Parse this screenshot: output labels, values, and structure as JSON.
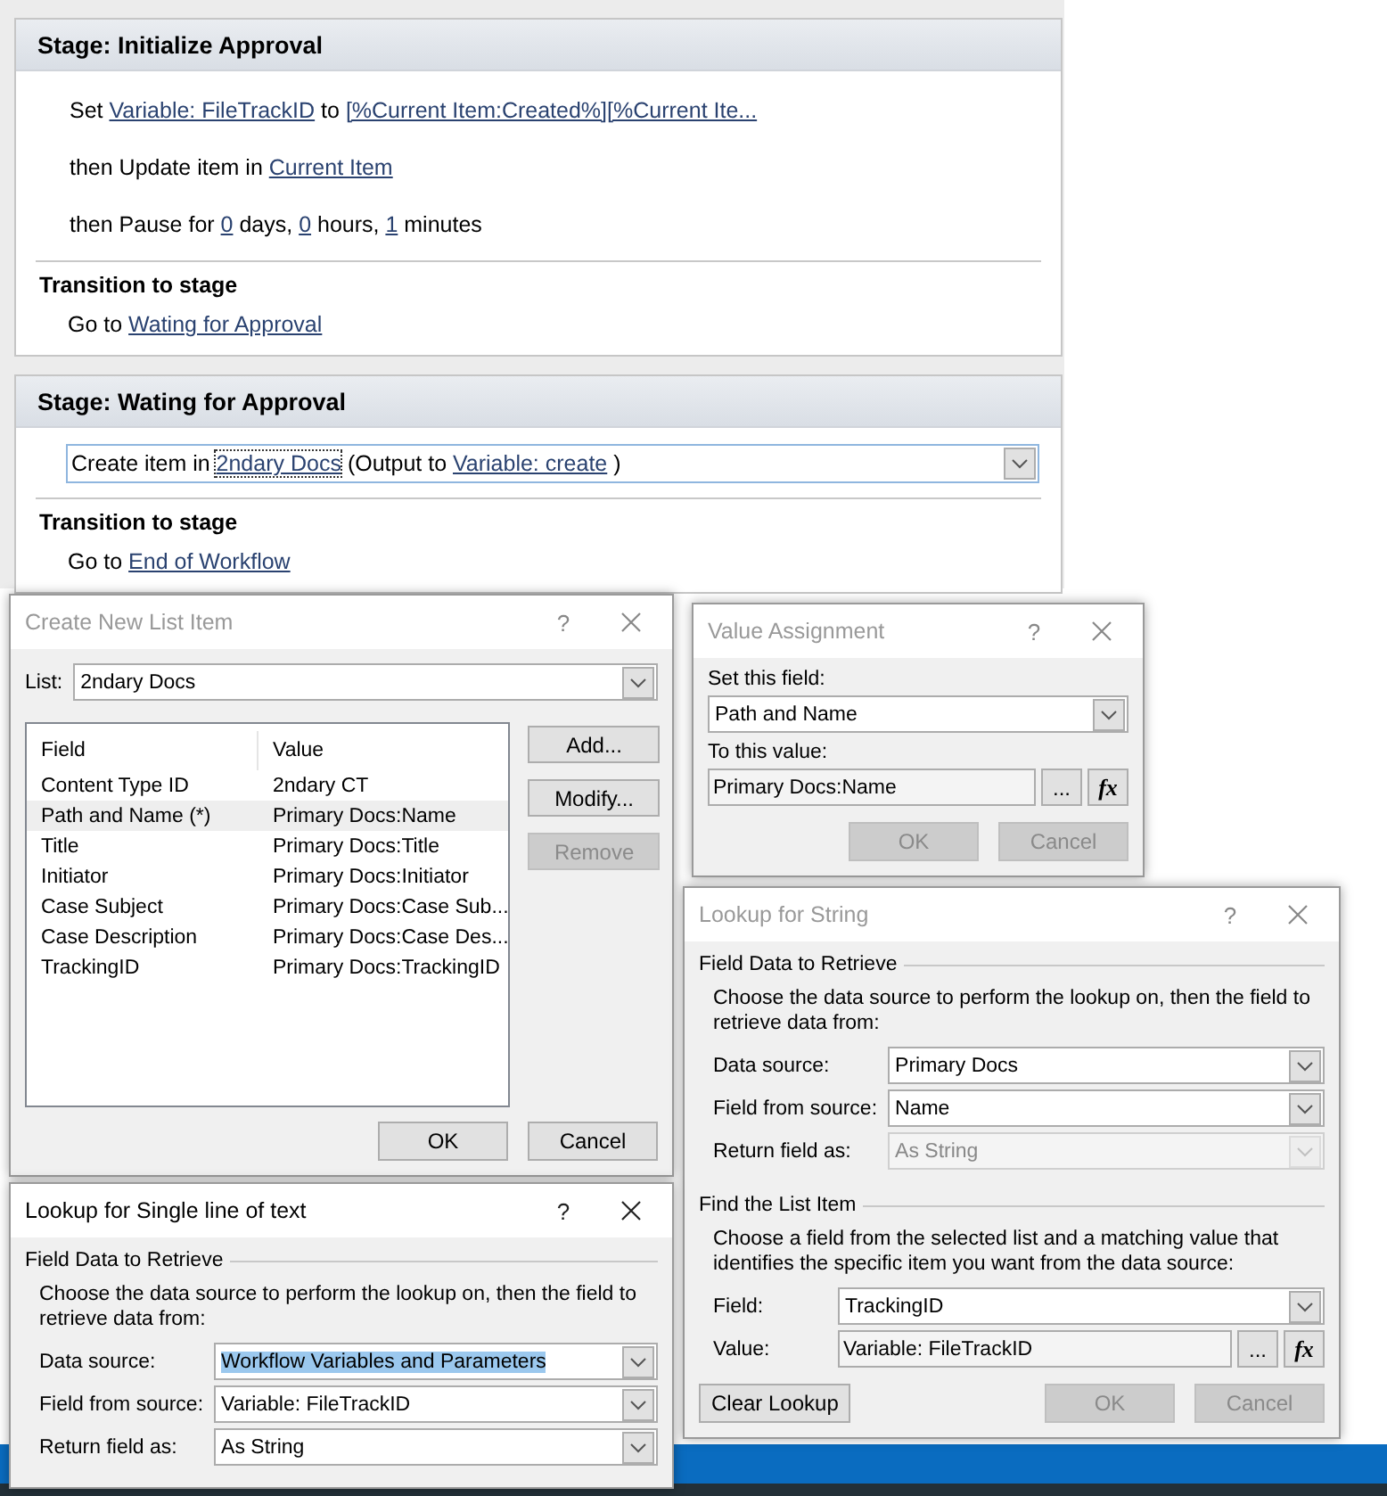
{
  "stages": [
    {
      "title": "Stage: Initialize Approval",
      "actions": [
        {
          "selected": false,
          "parts": [
            {
              "kind": "text",
              "text": "Set "
            },
            {
              "kind": "link",
              "text": "Variable: FileTrackID"
            },
            {
              "kind": "text",
              "text": " to "
            },
            {
              "kind": "link",
              "text": "[%Current Item:Created%][%Current Ite..."
            }
          ]
        },
        {
          "selected": false,
          "parts": [
            {
              "kind": "text",
              "text": "then Update item in "
            },
            {
              "kind": "link",
              "text": "Current Item"
            }
          ]
        },
        {
          "selected": false,
          "parts": [
            {
              "kind": "text",
              "text": "then Pause for "
            },
            {
              "kind": "link",
              "text": "0"
            },
            {
              "kind": "text",
              "text": " days, "
            },
            {
              "kind": "link",
              "text": "0"
            },
            {
              "kind": "text",
              "text": " hours, "
            },
            {
              "kind": "link",
              "text": "1"
            },
            {
              "kind": "text",
              "text": " minutes"
            }
          ]
        }
      ],
      "transition": {
        "heading": "Transition to stage",
        "parts": [
          {
            "kind": "text",
            "text": "Go to "
          },
          {
            "kind": "link",
            "text": "Wating for Approval"
          }
        ]
      }
    },
    {
      "title": "Stage: Wating for Approval",
      "actions": [
        {
          "selected": true,
          "parts": [
            {
              "kind": "text",
              "text": "Create item in "
            },
            {
              "kind": "focused_link",
              "text": "2ndary Docs"
            },
            {
              "kind": "text",
              "text": " (Output to "
            },
            {
              "kind": "link",
              "text": "Variable: create"
            },
            {
              "kind": "text",
              "text": " )"
            }
          ]
        }
      ],
      "transition": {
        "heading": "Transition to stage",
        "parts": [
          {
            "kind": "text",
            "text": "Go to "
          },
          {
            "kind": "link",
            "text": "End of Workflow"
          }
        ]
      }
    }
  ],
  "create_item_dialog": {
    "title": "Create New List Item",
    "active": false,
    "help": "?",
    "list_label": "List:",
    "list_value": "2ndary Docs",
    "columns": [
      "Field",
      "Value"
    ],
    "rows": [
      {
        "field": "Content Type ID",
        "value": "2ndary CT",
        "selected": false
      },
      {
        "field": "Path and Name (*)",
        "value": "Primary Docs:Name",
        "selected": true
      },
      {
        "field": "Title",
        "value": "Primary Docs:Title",
        "selected": false
      },
      {
        "field": "Initiator",
        "value": "Primary Docs:Initiator",
        "selected": false
      },
      {
        "field": "Case Subject",
        "value": "Primary Docs:Case Sub...",
        "selected": false
      },
      {
        "field": "Case Description",
        "value": "Primary Docs:Case Des...",
        "selected": false
      },
      {
        "field": "TrackingID",
        "value": "Primary Docs:TrackingID",
        "selected": false
      }
    ],
    "side_buttons": [
      {
        "label": "Add...",
        "disabled": false
      },
      {
        "label": "Modify...",
        "disabled": false
      },
      {
        "label": "Remove",
        "disabled": true
      }
    ],
    "footer_buttons": [
      {
        "label": "OK",
        "disabled": false
      },
      {
        "label": "Cancel",
        "disabled": false
      }
    ]
  },
  "value_dialog": {
    "title": "Value Assignment",
    "active": false,
    "help": "?",
    "set_label": "Set this field:",
    "set_value": "Path and Name",
    "to_label": "To this value:",
    "to_value": "Primary Docs:Name",
    "browse": "...",
    "formula": "fx",
    "footer_buttons": [
      {
        "label": "OK",
        "disabled": true
      },
      {
        "label": "Cancel",
        "disabled": true
      }
    ]
  },
  "lookup_string_dialog": {
    "title": "Lookup for String",
    "active": false,
    "help": "?",
    "sections": [
      {
        "heading": "Field Data to Retrieve",
        "description": "Choose the data source to perform the lookup on, then the field to retrieve data from:",
        "rows": [
          {
            "kind": "dropdown",
            "label": "Data source:",
            "value": "Primary Docs",
            "disabled": false,
            "highlighted": false
          },
          {
            "kind": "dropdown",
            "label": "Field from source:",
            "value": "Name",
            "disabled": false,
            "highlighted": false
          },
          {
            "kind": "dropdown",
            "label": "Return field as:",
            "value": "As String",
            "disabled": true,
            "highlighted": false
          }
        ]
      },
      {
        "heading": "Find the List Item",
        "description": "Choose a field from the selected list and a matching value that identifies the specific item you want from the data source:",
        "rows": [
          {
            "kind": "dropdown",
            "label": "Field:",
            "value": "TrackingID",
            "disabled": false,
            "highlighted": false
          },
          {
            "kind": "formula_field",
            "label": "Value:",
            "value": "Variable: FileTrackID",
            "browse": "...",
            "formula": "fx"
          }
        ]
      }
    ],
    "left_button": {
      "label": "Clear Lookup",
      "disabled": false
    },
    "footer_buttons": [
      {
        "label": "OK",
        "disabled": true
      },
      {
        "label": "Cancel",
        "disabled": true
      }
    ]
  },
  "lookup_text_dialog": {
    "title": "Lookup for Single line of text",
    "active": true,
    "help": "?",
    "sections": [
      {
        "heading": "Field Data to Retrieve",
        "description": "Choose the data source to perform the lookup on, then the field to retrieve data from:",
        "rows": [
          {
            "kind": "dropdown",
            "label": "Data source:",
            "value": "Workflow Variables and Parameters",
            "disabled": false,
            "highlighted": true
          },
          {
            "kind": "dropdown",
            "label": "Field from source:",
            "value": "Variable: FileTrackID",
            "disabled": false,
            "highlighted": false
          },
          {
            "kind": "dropdown",
            "label": "Return field as:",
            "value": "As String",
            "disabled": false,
            "highlighted": false
          }
        ]
      }
    ]
  }
}
